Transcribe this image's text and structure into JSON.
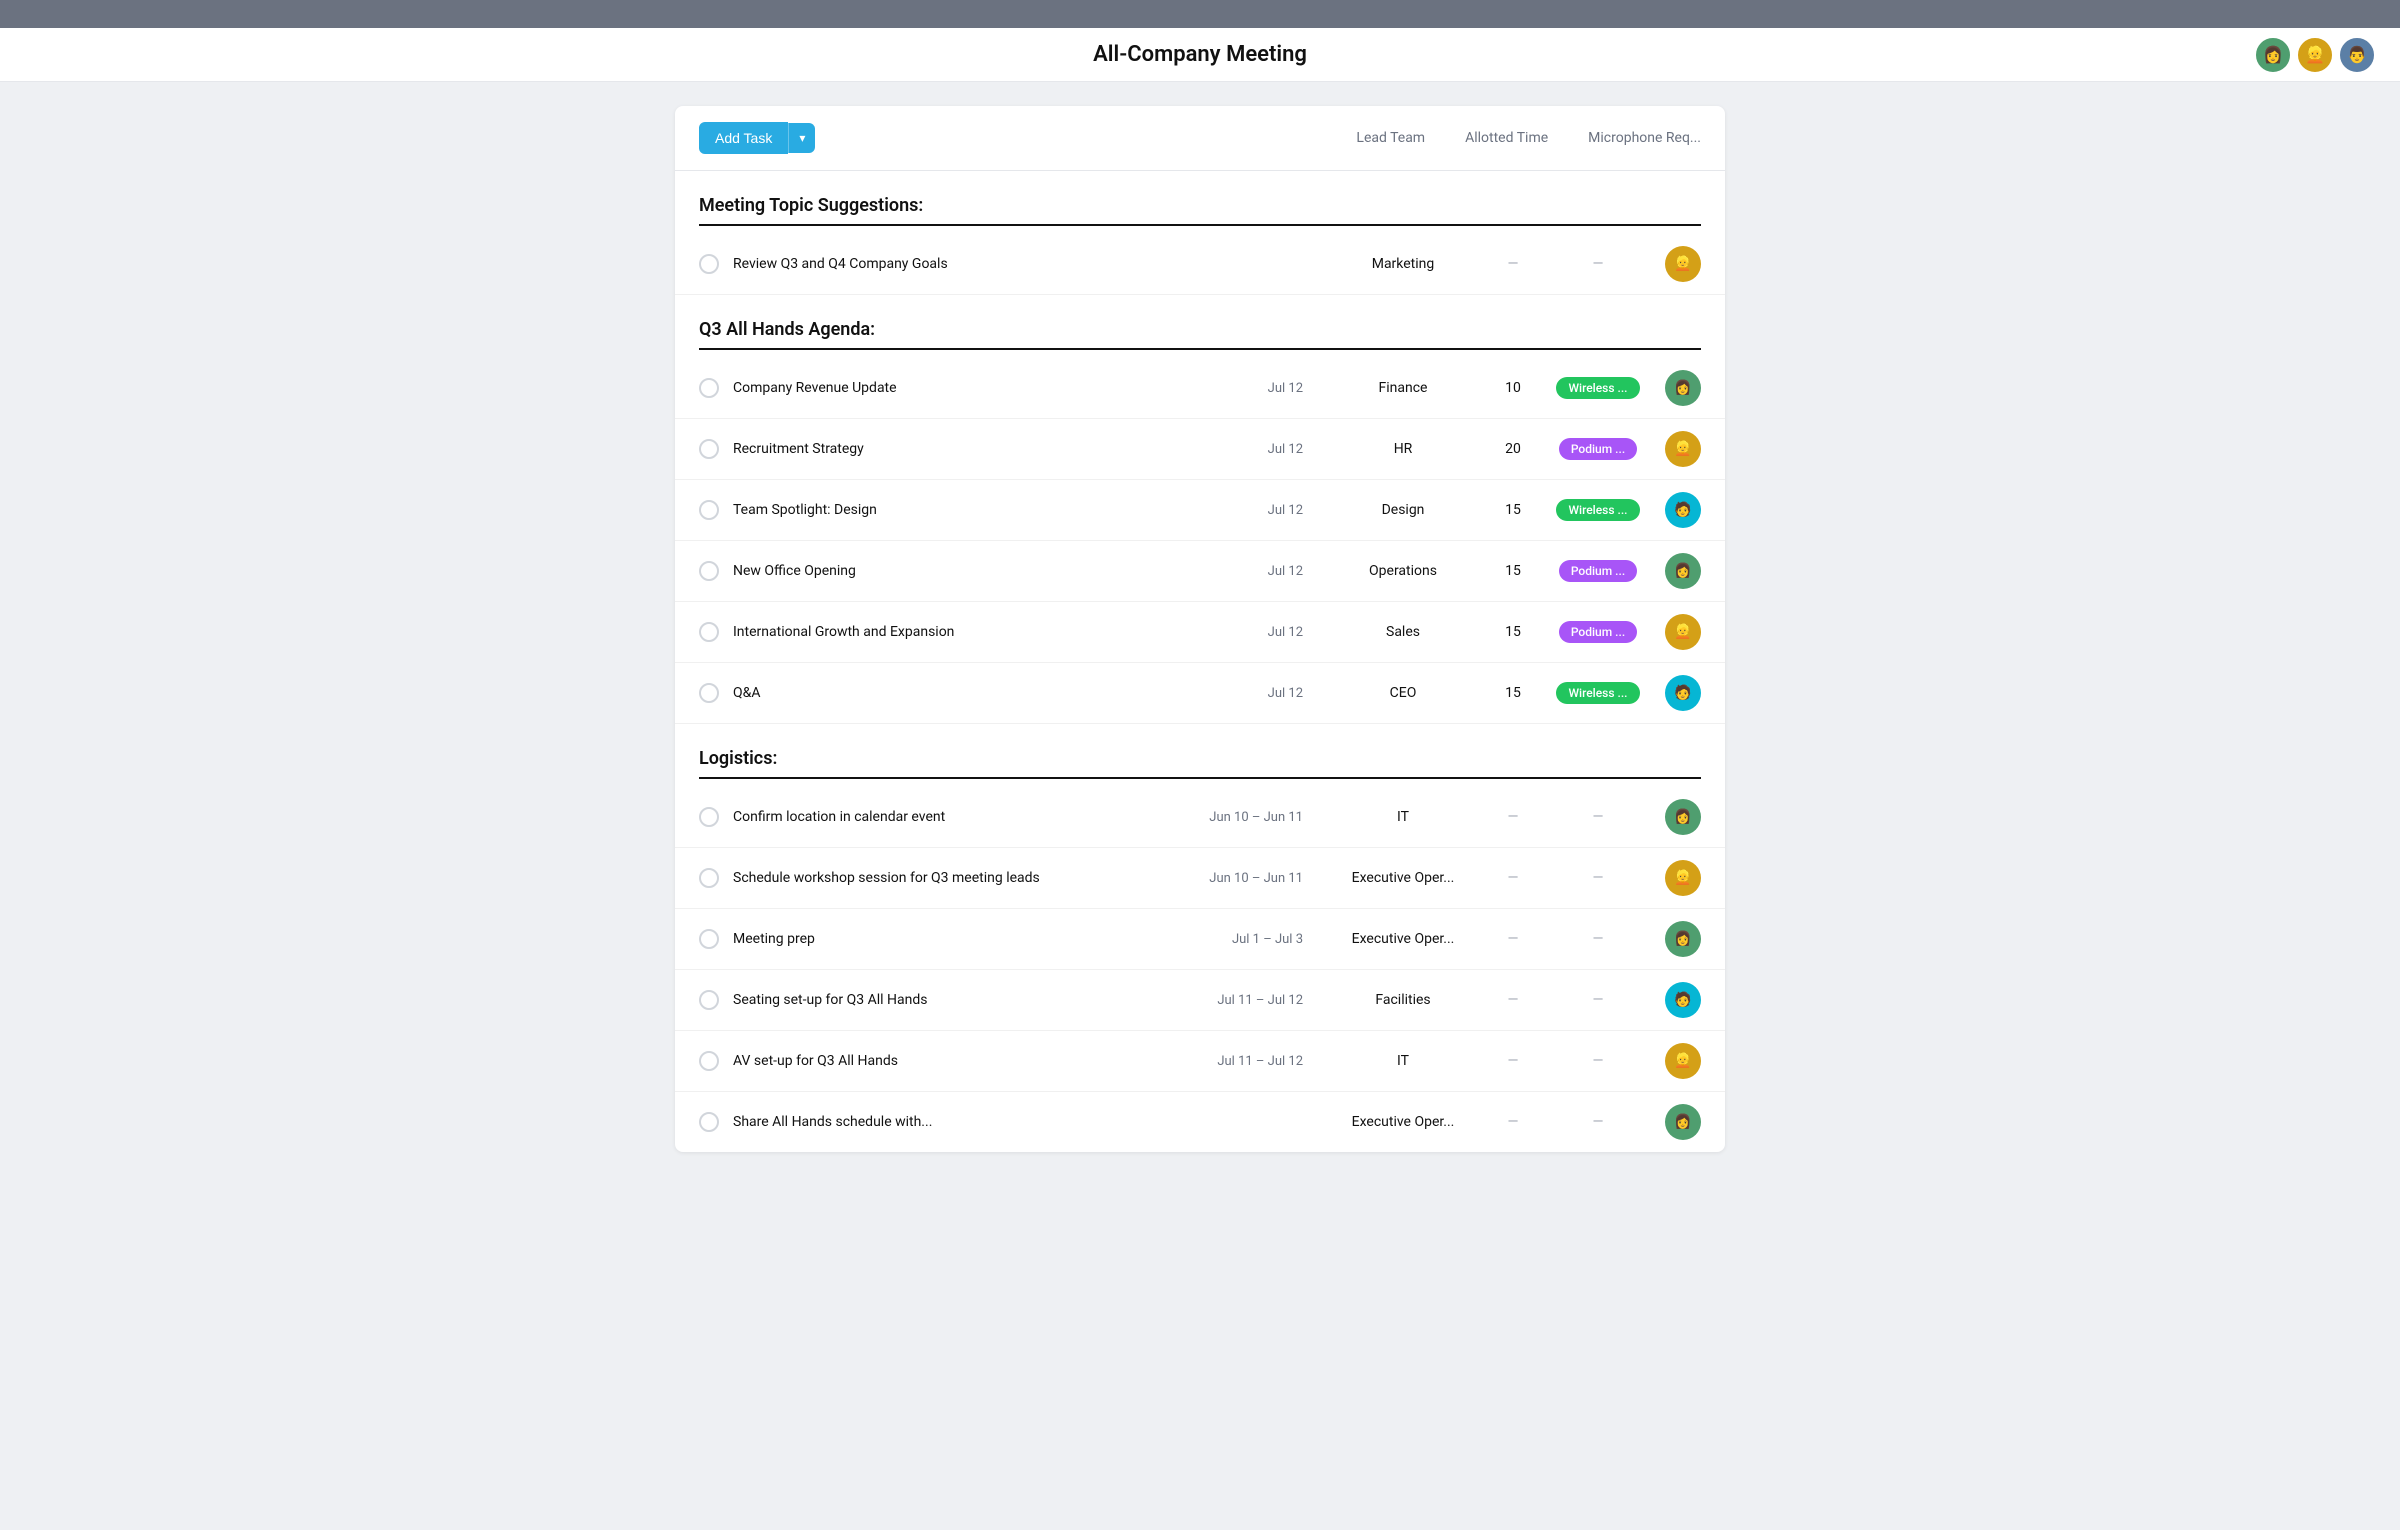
{
  "topbar": {},
  "header": {
    "title": "All-Company Meeting",
    "avatars": [
      {
        "id": "avatar-1",
        "color": "#4f9e6f",
        "emoji": "👩"
      },
      {
        "id": "avatar-2",
        "color": "#d4a017",
        "emoji": "👱"
      },
      {
        "id": "avatar-3",
        "color": "#5b7fa6",
        "emoji": "👨"
      }
    ]
  },
  "toolbar": {
    "add_task_label": "Add Task",
    "columns": [
      {
        "id": "lead-team",
        "label": "Lead Team"
      },
      {
        "id": "allotted-time",
        "label": "Allotted Time"
      },
      {
        "id": "microphone-req",
        "label": "Microphone Req..."
      }
    ]
  },
  "sections": [
    {
      "id": "meeting-topic-suggestions",
      "title": "Meeting Topic Suggestions:",
      "tasks": [
        {
          "id": "task-1",
          "name": "Review Q3 and Q4 Company Goals",
          "date": "",
          "team": "Marketing",
          "time": null,
          "mic": null,
          "avatarColor": "#d4a017",
          "avatarEmoji": "👱"
        }
      ]
    },
    {
      "id": "q3-all-hands",
      "title": "Q3 All Hands Agenda:",
      "tasks": [
        {
          "id": "task-2",
          "name": "Company Revenue Update",
          "date": "Jul 12",
          "team": "Finance",
          "time": 10,
          "mic": "Wireless ...",
          "micColor": "green",
          "avatarColor": "#4f9e6f",
          "avatarEmoji": "👩"
        },
        {
          "id": "task-3",
          "name": "Recruitment Strategy",
          "date": "Jul 12",
          "team": "HR",
          "time": 20,
          "mic": "Podium ...",
          "micColor": "purple",
          "avatarColor": "#d4a017",
          "avatarEmoji": "👱"
        },
        {
          "id": "task-4",
          "name": "Team Spotlight: Design",
          "date": "Jul 12",
          "team": "Design",
          "time": 15,
          "mic": "Wireless ...",
          "micColor": "cyan",
          "avatarColor": "#06b6d4",
          "avatarEmoji": "🧑"
        },
        {
          "id": "task-5",
          "name": "New Office Opening",
          "date": "Jul 12",
          "team": "Operations",
          "time": 15,
          "mic": "Podium ...",
          "micColor": "purple",
          "avatarColor": "#4f9e6f",
          "avatarEmoji": "👩"
        },
        {
          "id": "task-6",
          "name": "International Growth and Expansion",
          "date": "Jul 12",
          "team": "Sales",
          "time": 15,
          "mic": "Podium ...",
          "micColor": "purple",
          "avatarColor": "#d4a017",
          "avatarEmoji": "👱"
        },
        {
          "id": "task-7",
          "name": "Q&A",
          "date": "Jul 12",
          "team": "CEO",
          "time": 15,
          "mic": "Wireless ...",
          "micColor": "cyan",
          "avatarColor": "#06b6d4",
          "avatarEmoji": "🧑"
        }
      ]
    },
    {
      "id": "logistics",
      "title": "Logistics:",
      "tasks": [
        {
          "id": "task-8",
          "name": "Confirm location in calendar event",
          "date": "Jun 10 – Jun 11",
          "team": "IT",
          "time": null,
          "mic": null,
          "avatarColor": "#4f9e6f",
          "avatarEmoji": "👩"
        },
        {
          "id": "task-9",
          "name": "Schedule workshop session for Q3 meeting leads",
          "date": "Jun 10 – Jun 11",
          "team": "Executive Oper...",
          "time": null,
          "mic": null,
          "avatarColor": "#d4a017",
          "avatarEmoji": "👱"
        },
        {
          "id": "task-10",
          "name": "Meeting prep",
          "date": "Jul 1 – Jul 3",
          "team": "Executive Oper...",
          "time": null,
          "mic": null,
          "avatarColor": "#4f9e6f",
          "avatarEmoji": "👩"
        },
        {
          "id": "task-11",
          "name": "Seating set-up for Q3 All Hands",
          "date": "Jul 11 – Jul 12",
          "team": "Facilities",
          "time": null,
          "mic": null,
          "avatarColor": "#06b6d4",
          "avatarEmoji": "🧑"
        },
        {
          "id": "task-12",
          "name": "AV set-up for Q3 All Hands",
          "date": "Jul 11 – Jul 12",
          "team": "IT",
          "time": null,
          "mic": null,
          "avatarColor": "#d4a017",
          "avatarEmoji": "👱"
        },
        {
          "id": "task-13",
          "name": "Share All Hands schedule with...",
          "date": "",
          "team": "Executive Oper...",
          "time": null,
          "mic": null,
          "avatarColor": "#4f9e6f",
          "avatarEmoji": "👩"
        }
      ]
    }
  ]
}
